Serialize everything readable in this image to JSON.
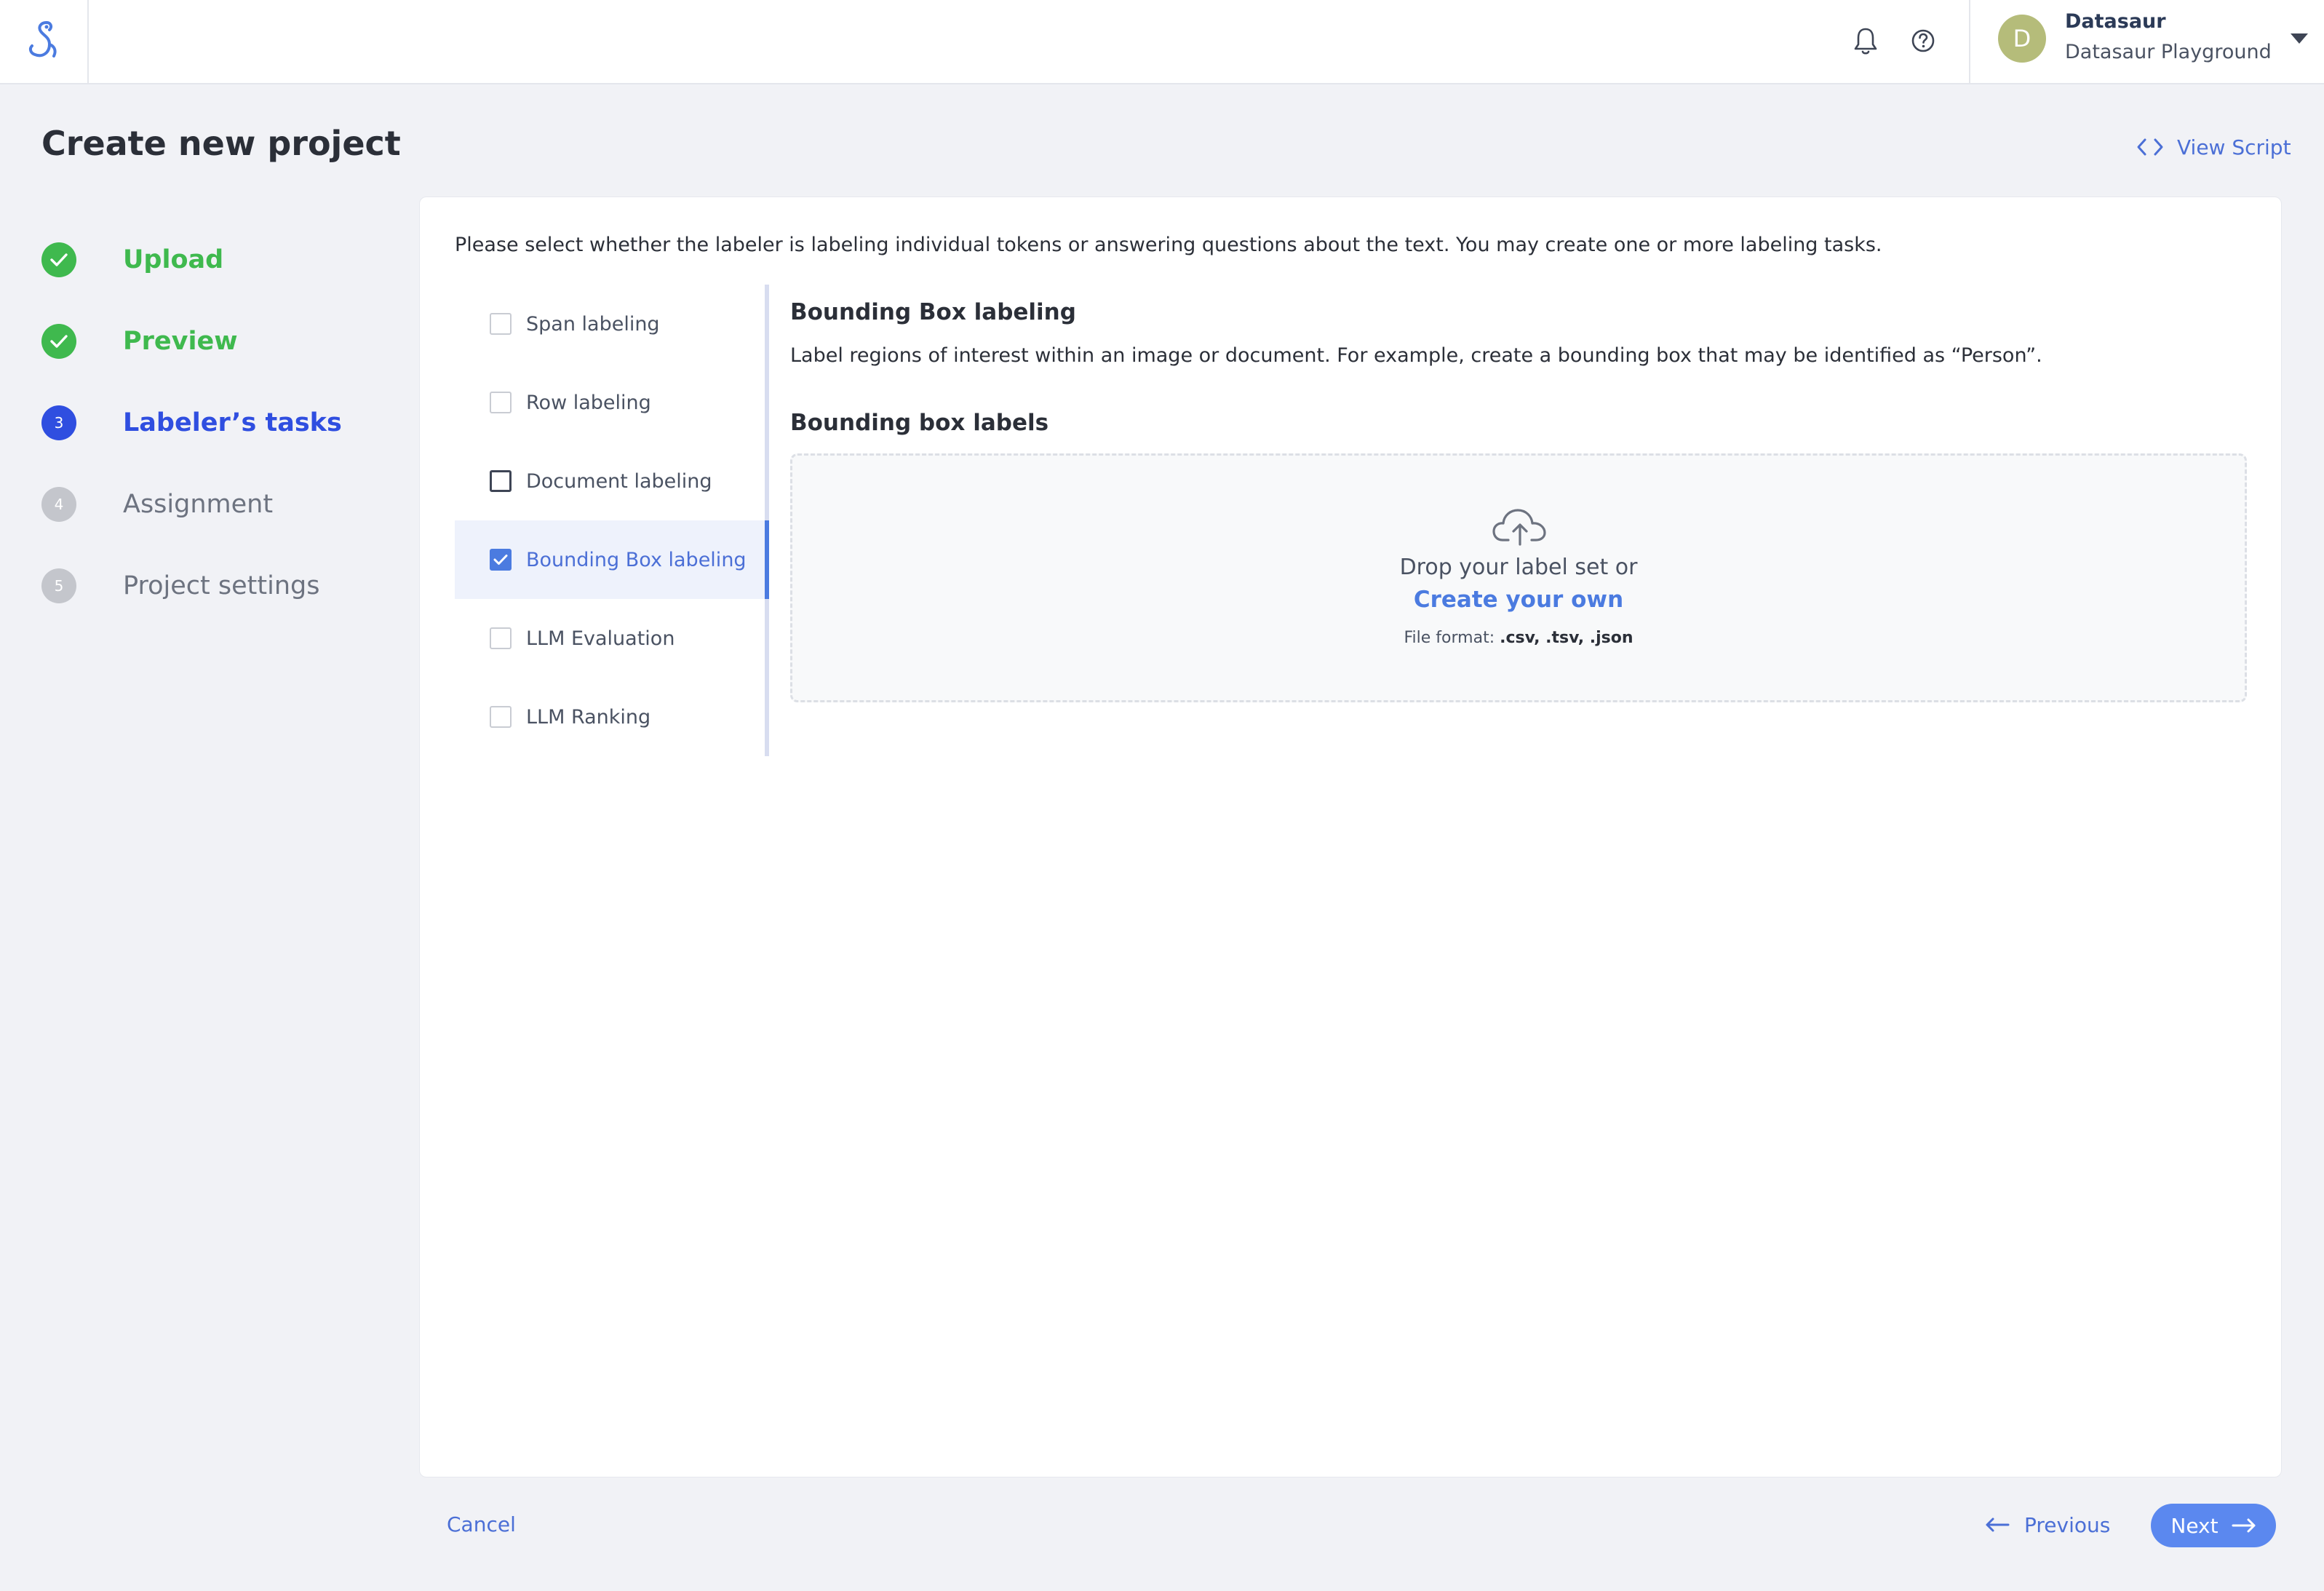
{
  "header": {
    "logo_icon": "datasaur-logo-icon",
    "notification_icon": "bell-icon",
    "help_icon": "help-circle-icon",
    "user": {
      "avatar_initial": "D",
      "avatar_color": "#b5bc7a",
      "name": "Datasaur",
      "workspace": "Datasaur Playground"
    }
  },
  "page": {
    "title": "Create new project",
    "view_script_label": "View Script"
  },
  "steps": [
    {
      "marker": "",
      "label": "Upload",
      "state": "done"
    },
    {
      "marker": "",
      "label": "Preview",
      "state": "done"
    },
    {
      "marker": "3",
      "label": "Labeler’s tasks",
      "state": "active"
    },
    {
      "marker": "4",
      "label": "Assignment",
      "state": "todo"
    },
    {
      "marker": "5",
      "label": "Project settings",
      "state": "todo"
    }
  ],
  "card": {
    "instruction": "Please select whether the labeler is labeling individual tokens or answering questions about the text. You may create one or more labeling tasks.",
    "tasks": [
      {
        "label": "Span labeling",
        "checked": false
      },
      {
        "label": "Row labeling",
        "checked": false
      },
      {
        "label": "Document labeling",
        "checked": false
      },
      {
        "label": "Bounding Box labeling",
        "checked": true
      },
      {
        "label": "LLM Evaluation",
        "checked": false
      },
      {
        "label": "LLM Ranking",
        "checked": false
      }
    ],
    "detail": {
      "title": "Bounding Box labeling",
      "description": "Label regions of interest within an image or document. For example, create a bounding box that may be identified as “Person”."
    },
    "labels_heading": "Bounding box labels",
    "dropzone": {
      "icon": "cloud-upload-icon",
      "text": "Drop your label set or",
      "link": "Create your own",
      "format_prefix": "File format:",
      "format_values": ".csv, .tsv, .json"
    }
  },
  "footer": {
    "cancel_label": "Cancel",
    "previous_label": "Previous",
    "next_label": "Next"
  },
  "colors": {
    "accent": "#4b7be0",
    "step_done": "#3fb94e",
    "step_active": "#2f4ee0",
    "background": "#f1f2f6"
  }
}
